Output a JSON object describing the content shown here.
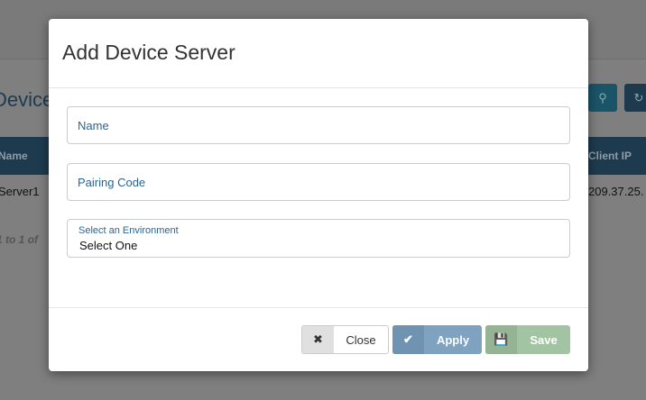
{
  "background": {
    "page_title": "Device",
    "table_headers": [
      "Name",
      "Client IP"
    ],
    "row": {
      "name": "Server1",
      "client_ip": "209.37.25."
    },
    "pagination_info": "1 to 1 of",
    "search_icon": "search-icon",
    "refresh_icon": "refresh-icon"
  },
  "modal": {
    "title": "Add Device Server",
    "name_placeholder": "Name",
    "pairing_placeholder": "Pairing Code",
    "environment_label": "Select an Environment",
    "environment_value": "Select One",
    "buttons": {
      "close": "Close",
      "apply": "Apply",
      "save": "Save"
    }
  },
  "colors": {
    "apply": "#7ea2bf",
    "save": "#a3c4a3",
    "header": "#1e3a4e",
    "link": "#2a6496"
  }
}
